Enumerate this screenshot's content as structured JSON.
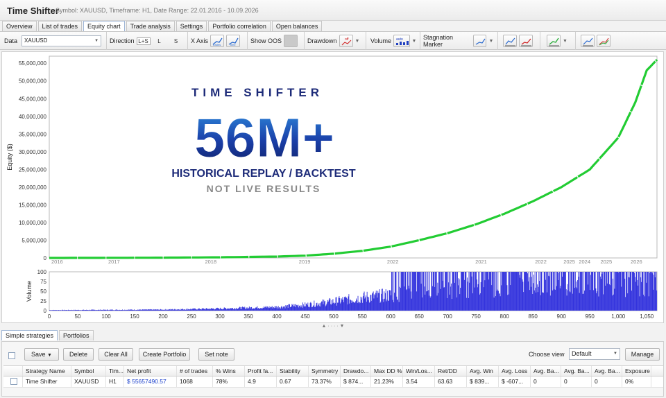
{
  "window": {
    "title": "Time Shifter",
    "subtitle": "Symbol: XAUUSD, Timeframe: H1, Date Range: 22.01.2016 - 10.09.2026"
  },
  "tabs": [
    {
      "label": "Overview",
      "active": false
    },
    {
      "label": "List of trades",
      "active": false
    },
    {
      "label": "Equity chart",
      "active": true
    },
    {
      "label": "Trade analysis",
      "active": false
    },
    {
      "label": "Settings",
      "active": false
    },
    {
      "label": "Portfolio correlation",
      "active": false
    },
    {
      "label": "Open balances",
      "active": false
    }
  ],
  "toolbar": {
    "data_label": "Data",
    "data_value": "XAUUSD",
    "direction_label": "Direction",
    "direction_options": [
      "L+S",
      "L",
      "S"
    ],
    "xaxis_label": "X Axis",
    "xaxis_trades": "trades",
    "xaxis_time": "time",
    "show_oos_label": "Show OOS",
    "drawdown_label": "Drawdown",
    "drawdown_icon_text": "off",
    "volume_label": "Volume",
    "volume_icon_text": "auto",
    "stagnation_label": "Stagnation Marker"
  },
  "overlay": {
    "line1": "TIME SHIFTER",
    "line2": "56M+",
    "line3": "HISTORICAL REPLAY / BACKTEST",
    "line4": "NOT LIVE RESULTS"
  },
  "chart_data": [
    {
      "type": "line",
      "ylabel": "Equity ($)",
      "ylim": [
        0,
        57000000
      ],
      "yticks": [
        "0",
        "5,000,000",
        "10,000,000",
        "15,000,000",
        "20,000,000",
        "25,000,000",
        "30,000,000",
        "35,000,000",
        "40,000,000",
        "45,000,000",
        "50,000,000",
        "55,000,000"
      ],
      "year_labels": [
        {
          "label": "2016",
          "trade": 0
        },
        {
          "label": "2017",
          "trade": 100
        },
        {
          "label": "2018",
          "trade": 270
        },
        {
          "label": "2019",
          "trade": 435
        },
        {
          "label": "2022",
          "trade": 590
        },
        {
          "label": "2021",
          "trade": 745
        },
        {
          "label": "2022",
          "trade": 850
        },
        {
          "label": "2025",
          "trade": 900
        },
        {
          "label": "2024",
          "trade": 927
        },
        {
          "label": "2025",
          "trade": 965
        },
        {
          "label": "2026",
          "trade": 1018
        }
      ],
      "series": [
        {
          "color": "#22cc33",
          "x": [
            0,
            100,
            200,
            300,
            400,
            450,
            500,
            550,
            600,
            650,
            700,
            750,
            800,
            850,
            900,
            950,
            1000,
            1030,
            1050,
            1068
          ],
          "y": [
            0,
            30000,
            80000,
            180000,
            400000,
            650000,
            1200000,
            2000000,
            3200000,
            5000000,
            7000000,
            9500000,
            12500000,
            16000000,
            20000000,
            25000000,
            34000000,
            44000000,
            53000000,
            56000000
          ]
        }
      ]
    },
    {
      "type": "bar",
      "ylabel": "Volume",
      "ylim": [
        0,
        100
      ],
      "yticks": [
        "0",
        "25",
        "50",
        "75",
        "100"
      ],
      "xlim": [
        0,
        1068
      ],
      "xticks": [
        "0",
        "50",
        "100",
        "150",
        "200",
        "250",
        "300",
        "350",
        "400",
        "450",
        "500",
        "550",
        "600",
        "650",
        "700",
        "750",
        "800",
        "850",
        "900",
        "950",
        "1,000",
        "1,050"
      ],
      "bar_color": "#3333dd",
      "envelope": {
        "x": [
          0,
          200,
          300,
          400,
          450,
          500,
          550,
          600,
          650,
          700,
          750,
          800,
          850,
          900,
          950,
          1000,
          1068
        ],
        "y": [
          2,
          4,
          8,
          14,
          22,
          35,
          50,
          60,
          72,
          82,
          92,
          96,
          98,
          100,
          100,
          100,
          100
        ]
      }
    }
  ],
  "bottom_tabs": [
    {
      "label": "Simple strategies",
      "active": true
    },
    {
      "label": "Portfolios",
      "active": false
    }
  ],
  "actions": {
    "save": "Save",
    "delete": "Delete",
    "clear_all": "Clear All",
    "create_portfolio": "Create Portfolio",
    "set_note": "Set note",
    "choose_view_label": "Choose view",
    "view_value": "Default",
    "manage": "Manage"
  },
  "table": {
    "headers": [
      "Strategy Name",
      "Symbol",
      "Tim...",
      "Net profit",
      "# of trades",
      "% Wins",
      "Profit fa...",
      "Stability",
      "Symmetry",
      "Drawdo...",
      "Max DD %",
      "Win/Los...",
      "Ret/DD",
      "Avg. Win",
      "Avg. Loss",
      "Avg. Ba...",
      "Avg. Ba...",
      "Avg. Ba...",
      "Exposure"
    ],
    "rows": [
      [
        "Time Shifter",
        "XAUUSD",
        "H1",
        "$ 55657490.57",
        "1068",
        "78%",
        "4.9",
        "0.67",
        "73.37%",
        "$ 874...",
        "21.23%",
        "3.54",
        "63.63",
        "$ 839...",
        "$ -607...",
        "0",
        "0",
        "0",
        "0%"
      ]
    ],
    "profit_color": "#1a3fcc"
  },
  "colors": {
    "equity": "#22cc33",
    "volume": "#3333dd",
    "overlay_text": "#1c2a78",
    "overlay_muted": "#888888"
  }
}
